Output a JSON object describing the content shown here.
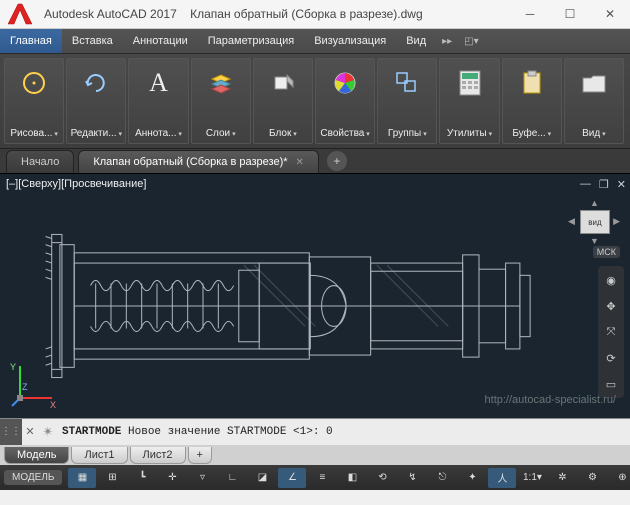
{
  "title": {
    "app": "Autodesk AutoCAD 2017",
    "file": "Клапан обратный (Сборка в разрезе).dwg"
  },
  "menu": {
    "items": [
      "Главная",
      "Вставка",
      "Аннотации",
      "Параметризация",
      "Визуализация",
      "Вид"
    ],
    "active": 0
  },
  "ribbon": [
    {
      "label": "Рисова..."
    },
    {
      "label": "Редакти..."
    },
    {
      "label": "Аннота..."
    },
    {
      "label": "Слои"
    },
    {
      "label": "Блок"
    },
    {
      "label": "Свойства"
    },
    {
      "label": "Группы"
    },
    {
      "label": "Утилиты"
    },
    {
      "label": "Буфе..."
    },
    {
      "label": "Вид"
    }
  ],
  "filetabs": {
    "start": "Начало",
    "active": "Клапан обратный (Сборка в разрезе)*"
  },
  "viewport": {
    "label": "[–][Сверху][Просвечивание]",
    "wcs": "МСК",
    "watermark": "http://autocad-specialist.ru/",
    "cube_face": "вид"
  },
  "command": {
    "text_bold": "STARTMODE",
    "text_rest": " Новое значение STARTMODE <1>:  0"
  },
  "layouts": {
    "model": "Модель",
    "sheet1": "Лист1",
    "sheet2": "Лист2",
    "add": "+"
  },
  "status": {
    "model": "МОДЕЛЬ",
    "scale": "1:1"
  },
  "axes": {
    "x": "X",
    "y": "Y",
    "z": "Z"
  }
}
